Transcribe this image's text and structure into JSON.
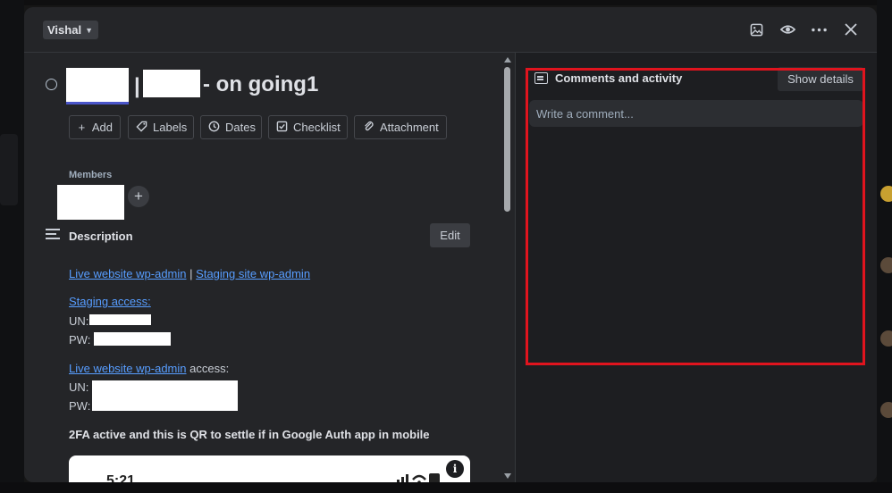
{
  "header": {
    "list_name": "Vishal",
    "icons": [
      "image-icon",
      "eye-icon",
      "more-icon",
      "close-icon"
    ]
  },
  "card": {
    "title_suffix": "- on going1",
    "title_separator": "|",
    "actions": [
      {
        "label": "Add",
        "icon": "+"
      },
      {
        "label": "Labels",
        "icon": "tag"
      },
      {
        "label": "Dates",
        "icon": "clock"
      },
      {
        "label": "Checklist",
        "icon": "check"
      },
      {
        "label": "Attachment",
        "icon": "paperclip"
      }
    ],
    "members_label": "Members",
    "add_member": "+"
  },
  "description": {
    "title": "Description",
    "edit_label": "Edit",
    "link_live_admin": "Live website wp-admin",
    "pipe": "|",
    "link_staging_admin": "Staging site wp-admin",
    "link_staging_access": "Staging access:",
    "un_label": "UN:",
    "pw_label": "PW:",
    "link_live_admin_2": "Live website wp-admin",
    "access_suffix": " access:",
    "un_label_2": "UN:",
    "pw_label_2": "PW:",
    "twofa_note": "2FA active and this is QR to settle if in Google Auth app in mobile",
    "phone_time": "5:21",
    "info_icon": "i"
  },
  "comments": {
    "title": "Comments and activity",
    "show_details_label": "Show details",
    "input_placeholder": "Write a comment..."
  },
  "colors": {
    "modal_bg": "#242528",
    "link": "#579dff",
    "highlight": "#e0141e"
  }
}
